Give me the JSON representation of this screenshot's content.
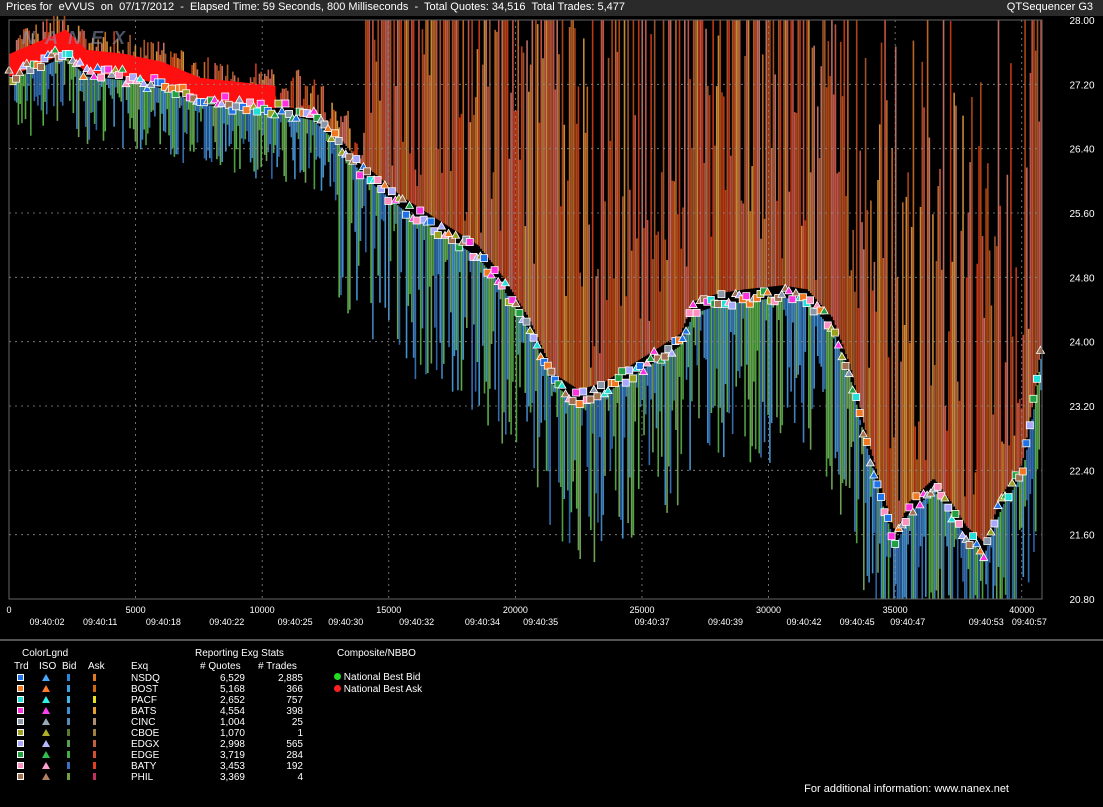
{
  "header": {
    "left": "Prices for  eVVUS  on  07/17/2012  -  Elapsed Time: 59 Seconds, 800 Milliseconds  -  Total Quotes: 34,516  Total Trades: 5,477",
    "right": "QTSequencer G3"
  },
  "watermark": "NANEX",
  "chart_data": {
    "type": "scatter",
    "title": "Prices for eVVUS on 07/17/2012",
    "ylim": [
      20.8,
      28.0
    ],
    "xlim": [
      0,
      40800
    ],
    "y_ticks": [
      "28.00",
      "27.20",
      "26.40",
      "25.60",
      "24.80",
      "24.00",
      "23.20",
      "22.40",
      "21.60",
      "20.80"
    ],
    "x_ticks": [
      "0",
      "5000",
      "10000",
      "15000",
      "20000",
      "25000",
      "30000",
      "35000",
      "40000"
    ],
    "time_labels": [
      "09:40:02",
      "09:40:11",
      "09:40:18",
      "09:40:22",
      "09:40:25",
      "09:40:30",
      "09:40:32",
      "09:40:34",
      "09:40:35",
      "09:40:37",
      "09:40:39",
      "09:40:42",
      "09:40:45",
      "09:40:47",
      "09:40:53",
      "09:40:57"
    ],
    "grid": true,
    "trade_path": [
      [
        0,
        27.3
      ],
      [
        1500,
        27.5
      ],
      [
        2200,
        27.6
      ],
      [
        3000,
        27.35
      ],
      [
        4500,
        27.3
      ],
      [
        6000,
        27.2
      ],
      [
        7500,
        27.0
      ],
      [
        9000,
        26.95
      ],
      [
        10500,
        26.9
      ],
      [
        12000,
        26.8
      ],
      [
        13000,
        26.5
      ],
      [
        14000,
        26.1
      ],
      [
        15500,
        25.7
      ],
      [
        17000,
        25.4
      ],
      [
        18500,
        25.1
      ],
      [
        19500,
        24.7
      ],
      [
        20500,
        24.2
      ],
      [
        21500,
        23.5
      ],
      [
        22500,
        23.3
      ],
      [
        23500,
        23.4
      ],
      [
        24500,
        23.6
      ],
      [
        25500,
        23.8
      ],
      [
        26500,
        24.0
      ],
      [
        27000,
        24.4
      ],
      [
        28000,
        24.5
      ],
      [
        29000,
        24.55
      ],
      [
        30500,
        24.6
      ],
      [
        31500,
        24.55
      ],
      [
        32500,
        24.2
      ],
      [
        33200,
        23.6
      ],
      [
        33800,
        22.8
      ],
      [
        34500,
        22.0
      ],
      [
        35000,
        21.5
      ],
      [
        35500,
        21.9
      ],
      [
        36500,
        22.2
      ],
      [
        37200,
        21.9
      ],
      [
        37800,
        21.6
      ],
      [
        38500,
        21.4
      ],
      [
        39200,
        22.0
      ],
      [
        40000,
        22.4
      ],
      [
        40500,
        23.3
      ],
      [
        40800,
        24.0
      ]
    ]
  },
  "legend": {
    "title": "ColorLgnd",
    "col_headers": [
      "Trd",
      "ISO",
      "Bid",
      "Ask"
    ],
    "exq_header": "Exq",
    "stats_title": "Reporting Exg Stats",
    "quotes_header": "# Quotes",
    "trades_header": "# Trades",
    "nbbo_title": "Composite/NBBO",
    "nbbo": [
      {
        "label": "National Best Bid",
        "color": "#22dd22"
      },
      {
        "label": "National Best Ask",
        "color": "#ff2020"
      }
    ],
    "rows": [
      {
        "exq": "NSDQ",
        "quotes": "6,529",
        "trades": "2,885",
        "trd": "#1e73e8",
        "iso": "#4aa8ff",
        "bid": "#2c86d8",
        "ask": "#e07a20"
      },
      {
        "exq": "BOST",
        "quotes": "5,168",
        "trades": "366",
        "trd": "#f07820",
        "iso": "#ff7a2a",
        "bid": "#3aa0e0",
        "ask": "#d06a10"
      },
      {
        "exq": "PACF",
        "quotes": "2,652",
        "trades": "757",
        "trd": "#22e0d8",
        "iso": "#30f0ea",
        "bid": "#40b8e8",
        "ask": "#e8e020"
      },
      {
        "exq": "BATS",
        "quotes": "4,554",
        "trades": "398",
        "trd": "#ff30e0",
        "iso": "#ff40f0",
        "bid": "#3c90d0",
        "ask": "#e8a030"
      },
      {
        "exq": "CINC",
        "quotes": "1,004",
        "trades": "25",
        "trd": "#8896a8",
        "iso": "#98a8b8",
        "bid": "#5a8ab0",
        "ask": "#b09070"
      },
      {
        "exq": "CBOE",
        "quotes": "1,070",
        "trades": "1",
        "trd": "#9aa020",
        "iso": "#b0b028",
        "bid": "#5a7a30",
        "ask": "#a08040"
      },
      {
        "exq": "EDGX",
        "quotes": "2,998",
        "trades": "565",
        "trd": "#a8a8ff",
        "iso": "#b8b8ff",
        "bid": "#5aa050",
        "ask": "#c06040"
      },
      {
        "exq": "EDGE",
        "quotes": "3,719",
        "trades": "284",
        "trd": "#20a040",
        "iso": "#30c050",
        "bid": "#40b040",
        "ask": "#d05030"
      },
      {
        "exq": "BATY",
        "quotes": "3,453",
        "trades": "192",
        "trd": "#ff90c0",
        "iso": "#ffa0d0",
        "bid": "#3a70c0",
        "ask": "#e04020"
      },
      {
        "exq": "PHIL",
        "quotes": "3,369",
        "trades": "4",
        "trd": "#a07050",
        "iso": "#b08060",
        "bid": "#70a040",
        "ask": "#c03060"
      }
    ]
  },
  "footer": "For additional information: www.nanex.net"
}
